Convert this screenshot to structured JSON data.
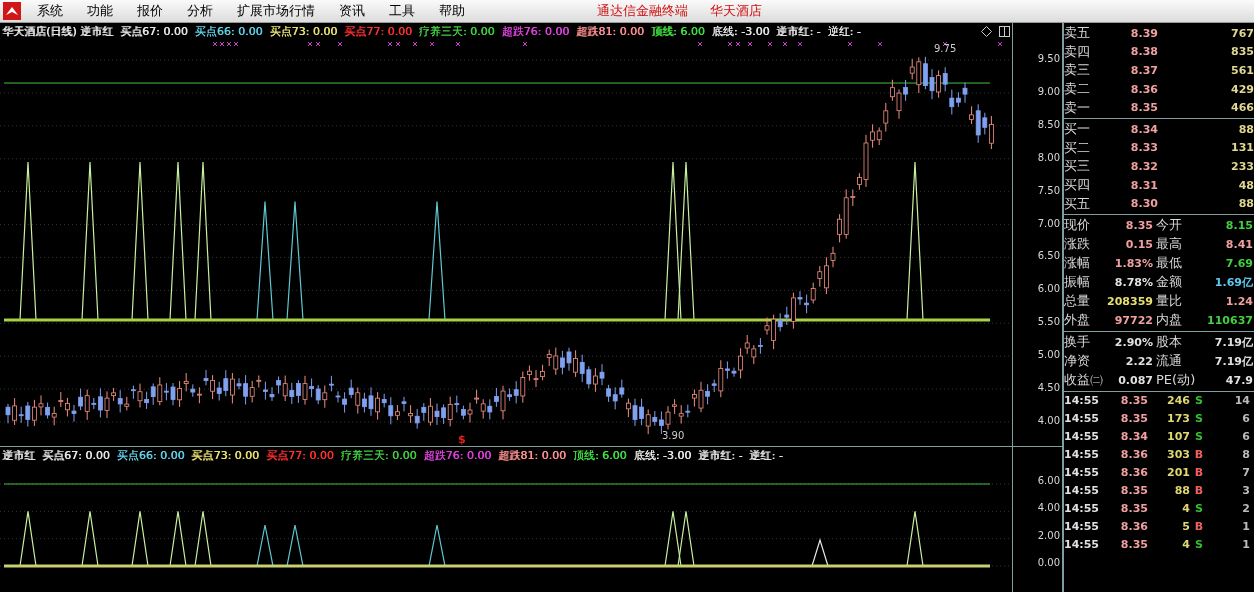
{
  "menu_bar": {
    "items": [
      "系统",
      "功能",
      "报价",
      "分析",
      "扩展市场行情",
      "资讯",
      "工具",
      "帮助"
    ],
    "title_parts": [
      "通达信金融终端",
      "华天酒店"
    ]
  },
  "main_chart": {
    "title": "华天酒店(日线) 逆市红",
    "indicators": [
      {
        "text": "买点67: 0.00",
        "color": "#e8e8e8"
      },
      {
        "text": "买点66: 0.00",
        "color": "#5fd0e8"
      },
      {
        "text": "买点73: 0.00",
        "color": "#e8e070"
      },
      {
        "text": "买点77: 0.00",
        "color": "#ff3030"
      },
      {
        "text": "疗养三天: 0.00",
        "color": "#40d040"
      },
      {
        "text": "超跌76: 0.00",
        "color": "#e040e0"
      },
      {
        "text": "超跌81: 0.00",
        "color": "#ff9090"
      },
      {
        "text": "顶线: 6.00",
        "color": "#40e040"
      },
      {
        "text": "底线: -3.00",
        "color": "#e8e8e8"
      },
      {
        "text": "逆市红: -",
        "color": "#e8e8e8"
      },
      {
        "text": "逆红: -",
        "color": "#e8e8e8"
      }
    ],
    "high_label": "9.75",
    "low_label": "3.90",
    "signal_mark": "$",
    "y_ticks": [
      "9.50",
      "9.00",
      "8.50",
      "8.00",
      "7.50",
      "7.00",
      "6.50",
      "6.00",
      "5.50",
      "5.00",
      "4.50",
      "4.00"
    ]
  },
  "sub_chart": {
    "title": "逆市红",
    "indicators": [
      {
        "text": "买点67: 0.00",
        "color": "#e8e8e8"
      },
      {
        "text": "买点66: 0.00",
        "color": "#5fd0e8"
      },
      {
        "text": "买点73: 0.00",
        "color": "#e8e070"
      },
      {
        "text": "买点77: 0.00",
        "color": "#ff3030"
      },
      {
        "text": "疗养三天: 0.00",
        "color": "#40d040"
      },
      {
        "text": "超跌76: 0.00",
        "color": "#e040e0"
      },
      {
        "text": "超跌81: 0.00",
        "color": "#ff9090"
      },
      {
        "text": "顶线: 6.00",
        "color": "#40e040"
      },
      {
        "text": "底线: -3.00",
        "color": "#e8e8e8"
      },
      {
        "text": "逆市红: -",
        "color": "#e8e8e8"
      },
      {
        "text": "逆红: -",
        "color": "#e8e8e8"
      }
    ],
    "y_ticks": [
      "6.00",
      "4.00",
      "2.00",
      "0.00"
    ]
  },
  "order_book": {
    "asks": [
      {
        "label": "卖五",
        "price": "8.39",
        "volume": "767"
      },
      {
        "label": "卖四",
        "price": "8.38",
        "volume": "835"
      },
      {
        "label": "卖三",
        "price": "8.37",
        "volume": "561"
      },
      {
        "label": "卖二",
        "price": "8.36",
        "volume": "429"
      },
      {
        "label": "卖一",
        "price": "8.35",
        "volume": "466"
      }
    ],
    "bids": [
      {
        "label": "买一",
        "price": "8.34",
        "volume": "88"
      },
      {
        "label": "买二",
        "price": "8.33",
        "volume": "131"
      },
      {
        "label": "买三",
        "price": "8.32",
        "volume": "233"
      },
      {
        "label": "买四",
        "price": "8.31",
        "volume": "48"
      },
      {
        "label": "买五",
        "price": "8.30",
        "volume": "88"
      }
    ]
  },
  "quote_stats": [
    {
      "label": "现价",
      "value": "8.35",
      "color": "#f0a0a0"
    },
    {
      "label": "今开",
      "value": "8.15",
      "color": "#40d040"
    },
    {
      "label": "涨跌",
      "value": "0.15",
      "color": "#f0a0a0"
    },
    {
      "label": "最高",
      "value": "8.41",
      "color": "#f0a0a0"
    },
    {
      "label": "涨幅",
      "value": "1.83%",
      "color": "#f0a0a0"
    },
    {
      "label": "最低",
      "value": "7.69",
      "color": "#40d040"
    },
    {
      "label": "振幅",
      "value": "8.78%",
      "color": "#e0e0e0"
    },
    {
      "label": "金额",
      "value": "1.69亿",
      "color": "#60c8f0"
    },
    {
      "label": "总量",
      "value": "208359",
      "color": "#e8e070"
    },
    {
      "label": "量比",
      "value": "1.24",
      "color": "#f0a0a0"
    },
    {
      "label": "外盘",
      "value": "97722",
      "color": "#f0a0a0"
    },
    {
      "label": "内盘",
      "value": "110637",
      "color": "#40d040"
    }
  ],
  "finance_stats": [
    {
      "label": "换手",
      "value": "2.90%"
    },
    {
      "label": "股本",
      "value": "7.19亿"
    },
    {
      "label": "净资",
      "value": "2.22"
    },
    {
      "label": "流通",
      "value": "7.19亿"
    },
    {
      "label": "收益㈡",
      "value": "0.087"
    },
    {
      "label": "PE(动)",
      "value": "47.9"
    }
  ],
  "ticks": [
    {
      "time": "14:55",
      "price": "8.35",
      "volume": "246",
      "side": "S",
      "color": "#30c030",
      "count": "14"
    },
    {
      "time": "14:55",
      "price": "8.35",
      "volume": "173",
      "side": "S",
      "color": "#30c030",
      "count": "6"
    },
    {
      "time": "14:55",
      "price": "8.34",
      "volume": "107",
      "side": "S",
      "color": "#30c030",
      "count": "6"
    },
    {
      "time": "14:55",
      "price": "8.36",
      "volume": "303",
      "side": "B",
      "color": "#f06060",
      "count": "8"
    },
    {
      "time": "14:55",
      "price": "8.36",
      "volume": "201",
      "side": "B",
      "color": "#f06060",
      "count": "7"
    },
    {
      "time": "14:55",
      "price": "8.35",
      "volume": "88",
      "side": "B",
      "color": "#f06060",
      "count": "3"
    },
    {
      "time": "14:55",
      "price": "8.35",
      "volume": "4",
      "side": "S",
      "color": "#30c030",
      "count": "2"
    },
    {
      "time": "14:55",
      "price": "8.36",
      "volume": "5",
      "side": "B",
      "color": "#f06060",
      "count": "1"
    },
    {
      "time": "14:55",
      "price": "8.35",
      "volume": "4",
      "side": "S",
      "color": "#30c030",
      "count": "1"
    }
  ]
}
